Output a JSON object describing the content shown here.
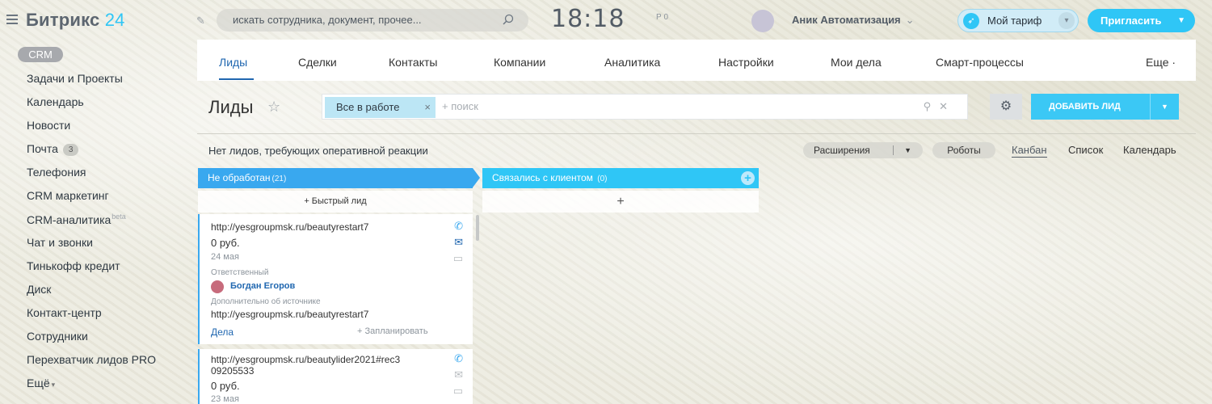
{
  "header": {
    "logo_text": "Битрикс",
    "logo_num": "24",
    "search_placeholder": "искать сотрудника, документ, прочее...",
    "clock": "18:18",
    "clock_sub": "Р 0",
    "user_name": "Аник Автоматизация",
    "tariff_label": "Мой тариф",
    "invite_label": "Пригласить"
  },
  "menu": {
    "crm_label": "CRM",
    "items": [
      {
        "label": "Задачи и Проекты"
      },
      {
        "label": "Календарь"
      },
      {
        "label": "Новости"
      },
      {
        "label": "Почта",
        "badge": "3"
      },
      {
        "label": "Телефония"
      },
      {
        "label": "CRM маркетинг"
      },
      {
        "label": "CRM-аналитика",
        "beta": "beta"
      },
      {
        "label": "Чат и звонки"
      },
      {
        "label": "Тинькофф кредит"
      },
      {
        "label": "Диск"
      },
      {
        "label": "Контакт-центр"
      },
      {
        "label": "Сотрудники"
      },
      {
        "label": "Перехватчик лидов PRO"
      },
      {
        "label": "Ещё"
      }
    ]
  },
  "tabs": [
    {
      "label": "Лиды",
      "active": true
    },
    {
      "label": "Сделки"
    },
    {
      "label": "Контакты"
    },
    {
      "label": "Компании"
    },
    {
      "label": "Аналитика"
    },
    {
      "label": "Настройки"
    },
    {
      "label": "Мои дела"
    },
    {
      "label": "Смарт-процессы"
    },
    {
      "label": "Еще"
    }
  ],
  "toolbar": {
    "page_title": "Лиды",
    "filter_chip": "Все в работе",
    "filter_placeholder": "+ поиск",
    "add_lead_label": "ДОБАВИТЬ ЛИД"
  },
  "notice": "Нет лидов, требующих оперативной реакции",
  "view": {
    "extensions_label": "Расширения",
    "robots_label": "Роботы",
    "tabs": [
      {
        "label": "Канбан",
        "active": true
      },
      {
        "label": "Список"
      },
      {
        "label": "Календарь"
      }
    ]
  },
  "kanban": {
    "columns": [
      {
        "title": "Не обработан",
        "count": "(21)",
        "color": "#39a8ef",
        "quick_label": "+ Быстрый лид"
      },
      {
        "title": "Связались с клиентом",
        "count": "(0)",
        "color": "#2fc6f6",
        "quick_label": "+"
      }
    ],
    "cards": [
      {
        "title": "http://yesgroupmsk.ru/beautyrestart7",
        "sum": "0 руб.",
        "date": "24 мая",
        "responsible_label": "Ответственный",
        "responsible_name": "Богдан Егоров",
        "source_label": "Дополнительно об источнике",
        "source_value": "http://yesgroupmsk.ru/beautyrestart7",
        "deals_label": "Дела",
        "plan_label": "+ Запланировать"
      },
      {
        "title_line1": "http://yesgroupmsk.ru/beautylider2021#rec3",
        "title_line2": "09205533",
        "sum": "0 руб.",
        "date": "23 мая"
      }
    ]
  }
}
